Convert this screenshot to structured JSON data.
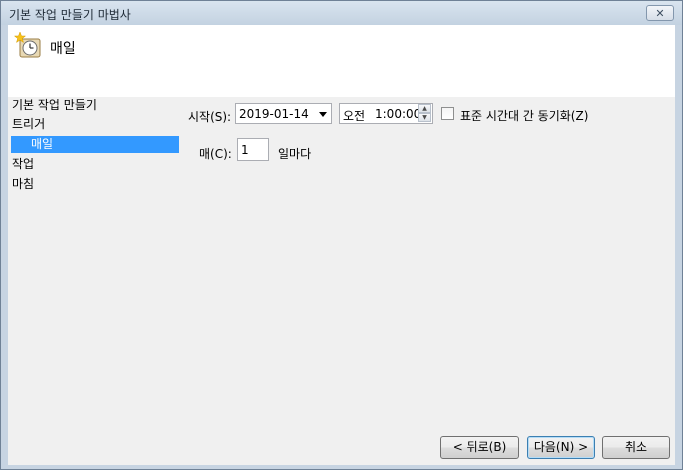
{
  "window": {
    "title": "기본 작업 만들기 마법사",
    "close_label": "✕"
  },
  "header": {
    "title": "매일",
    "icon": "clock-icon"
  },
  "nav": {
    "items": [
      {
        "label": "기본 작업 만들기",
        "selected": false
      },
      {
        "label": "트리거",
        "selected": false
      },
      {
        "label": "매일",
        "selected": true
      },
      {
        "label": "작업",
        "selected": false
      },
      {
        "label": "마침",
        "selected": false
      }
    ]
  },
  "form": {
    "start_label": "시작(S):",
    "start_date": "2019-01-14",
    "ampm": "오전",
    "time": "1:00:00",
    "sync_label": "표준 시간대 간 동기화(Z)",
    "sync_checked": false,
    "every_label": "매(C):",
    "every_value": "1",
    "every_unit": "일마다"
  },
  "buttons": {
    "back": "< 뒤로(B)",
    "next": "다음(N) >",
    "cancel": "취소"
  }
}
